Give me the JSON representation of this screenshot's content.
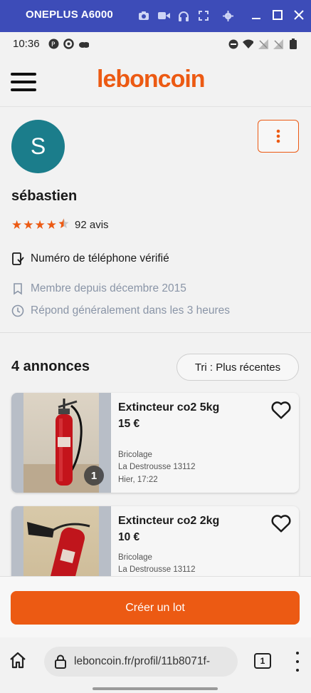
{
  "emulator": {
    "title": "ONEPLUS A6000"
  },
  "status_bar": {
    "time": "10:36"
  },
  "header": {
    "logo": "leboncoin"
  },
  "profile": {
    "avatar_letter": "S",
    "name": "sébastien",
    "rating": 4.5,
    "reviews_label": "92 avis",
    "verified_phone": "Numéro de téléphone vérifié",
    "member_since": "Membre depuis décembre 2015",
    "response_time": "Répond généralement dans les 3 heures"
  },
  "listings": {
    "count_label": "4 annonces",
    "sort_label": "Tri : Plus récentes",
    "items": [
      {
        "title": "Extincteur co2 5kg",
        "price": "15 €",
        "category": "Bricolage",
        "location": "La Destrousse 13112",
        "date": "Hier, 17:22",
        "photo_count": "1"
      },
      {
        "title": "Extincteur co2 2kg",
        "price": "10 €",
        "category": "Bricolage",
        "location": "La Destrousse 13112",
        "date": ""
      }
    ]
  },
  "cta": {
    "label": "Créer un lot"
  },
  "browser": {
    "url": "leboncoin.fr/profil/11b8071f-",
    "tab_count": "1"
  },
  "colors": {
    "brand": "#ec5a13",
    "avatar": "#1b7d8b",
    "emulator_bar": "#3d4cb8"
  }
}
